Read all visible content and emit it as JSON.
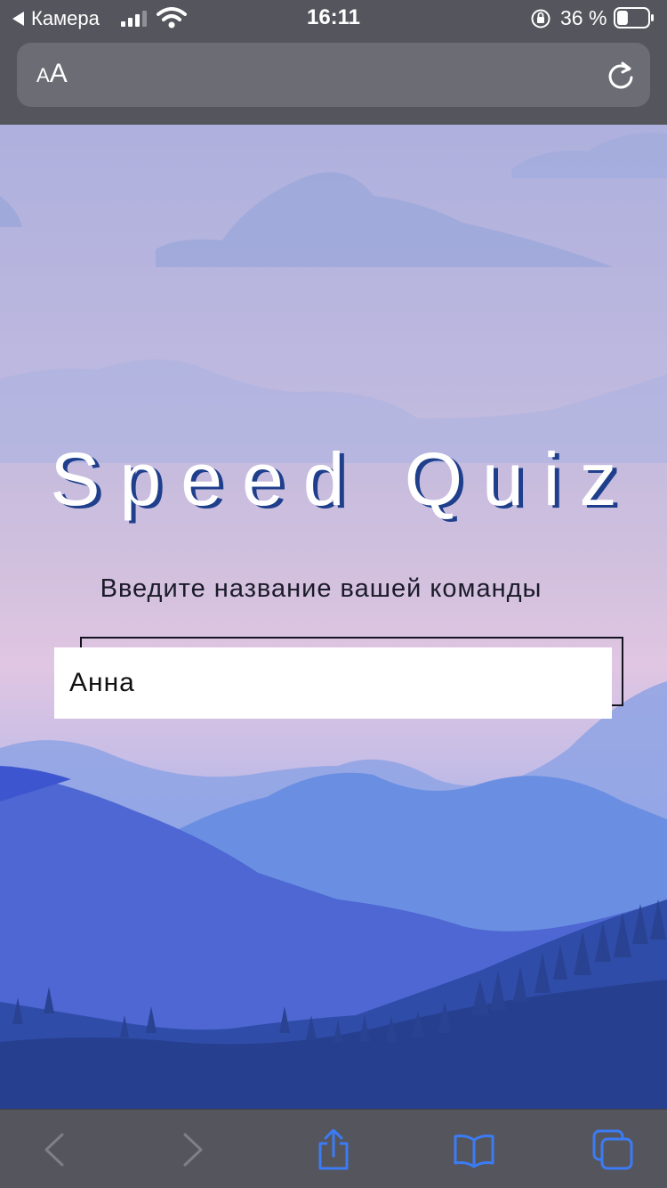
{
  "status_bar": {
    "back_app": "Камера",
    "time": "16:11",
    "battery_percent": "36 %",
    "battery_level": 0.36
  },
  "address_bar": {
    "text_size_small": "A",
    "text_size_big": "A",
    "url": ""
  },
  "page": {
    "title": "Speed Quiz",
    "subtitle": "Введите название вашей команды",
    "team_input_value": "Анна",
    "title_shadow_color": "#1f3f8c"
  },
  "toolbar": {
    "icons": [
      "chevron-left-icon",
      "chevron-right-icon",
      "share-icon",
      "bookmarks-icon",
      "tabs-icon"
    ],
    "active_color": "#3b7cf5",
    "disabled_color": "#8a8a90"
  }
}
